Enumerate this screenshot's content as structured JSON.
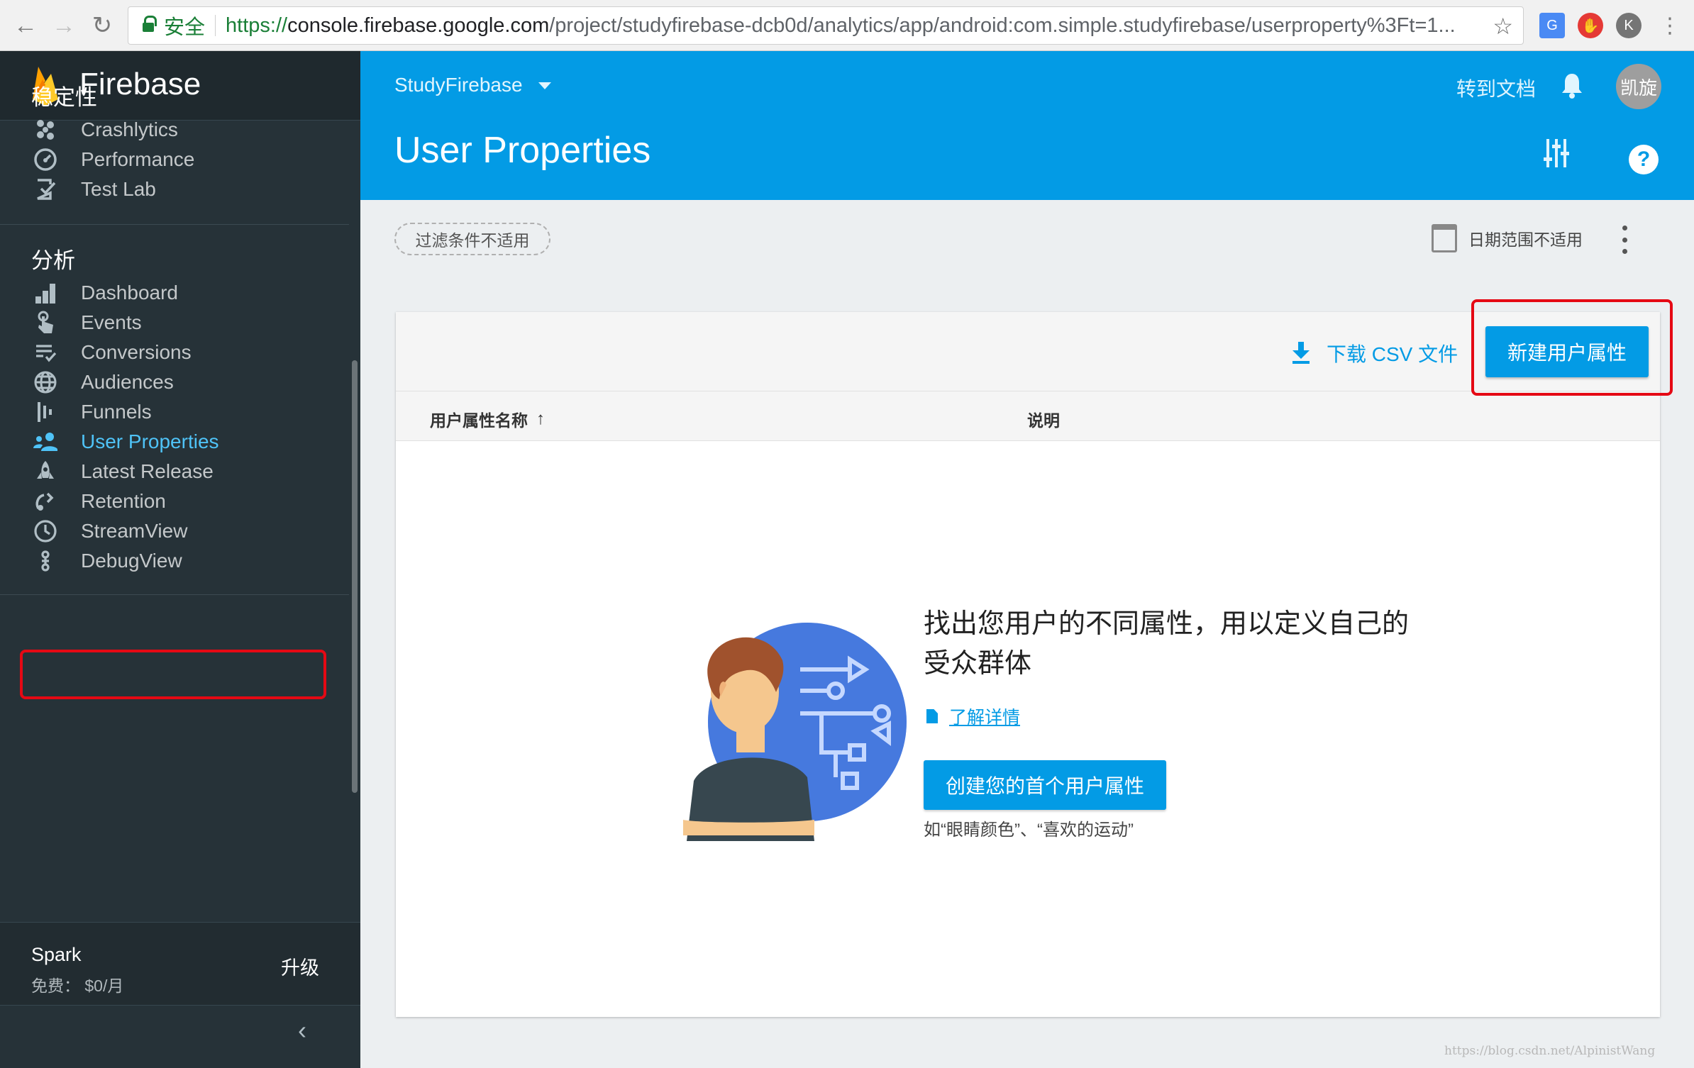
{
  "browser": {
    "secure_label": "安全",
    "url_scheme": "https://",
    "url_host": "console.firebase.google.com",
    "url_path": "/project/studyfirebase-dcb0d/analytics/app/android:com.simple.studyfirebase/userproperty%3Ft=1..."
  },
  "sidebar": {
    "brand": "Firebase",
    "section_stability": "稳定性",
    "stability_items": [
      {
        "label": "Crashlytics",
        "icon": "crashlytics-icon"
      },
      {
        "label": "Performance",
        "icon": "speed-gauge-icon"
      },
      {
        "label": "Test Lab",
        "icon": "checklist-icon"
      }
    ],
    "section_analytics": "分析",
    "analytics_items": [
      {
        "label": "Dashboard",
        "icon": "bar-chart-icon"
      },
      {
        "label": "Events",
        "icon": "touch-icon"
      },
      {
        "label": "Conversions",
        "icon": "conversions-icon"
      },
      {
        "label": "Audiences",
        "icon": "globe-icon"
      },
      {
        "label": "Funnels",
        "icon": "funnel-icon"
      },
      {
        "label": "User Properties",
        "icon": "people-icon",
        "active": true
      },
      {
        "label": "Latest Release",
        "icon": "rocket-icon"
      },
      {
        "label": "Retention",
        "icon": "retention-icon"
      },
      {
        "label": "StreamView",
        "icon": "clock-icon"
      },
      {
        "label": "DebugView",
        "icon": "debug-icon"
      }
    ],
    "plan_name": "Spark",
    "plan_price": "免费： $0/月",
    "upgrade_label": "升级"
  },
  "header": {
    "project_name": "StudyFirebase",
    "docs_link": "转到文档",
    "avatar_text": "凯旋",
    "title": "User Properties"
  },
  "filters": {
    "filter_chip": "过滤条件不适用",
    "date_range": "日期范围不适用"
  },
  "card": {
    "download_label": "下载 CSV 文件",
    "new_button": "新建用户属性",
    "columns": [
      "用户属性名称",
      "说明"
    ],
    "sort_indicator": "↑",
    "empty_title": "找出您用户的不同属性，用以定义自己的受众群体",
    "learn_more": "了解详情",
    "create_button": "创建您的首个用户属性",
    "hint": "如“眼睛颜色”、“喜欢的运动”"
  },
  "watermark": "https://blog.csdn.net/AlpinistWang",
  "colors": {
    "accent": "#039be5",
    "sidebar_bg": "#263238",
    "highlight": "#e50914"
  }
}
